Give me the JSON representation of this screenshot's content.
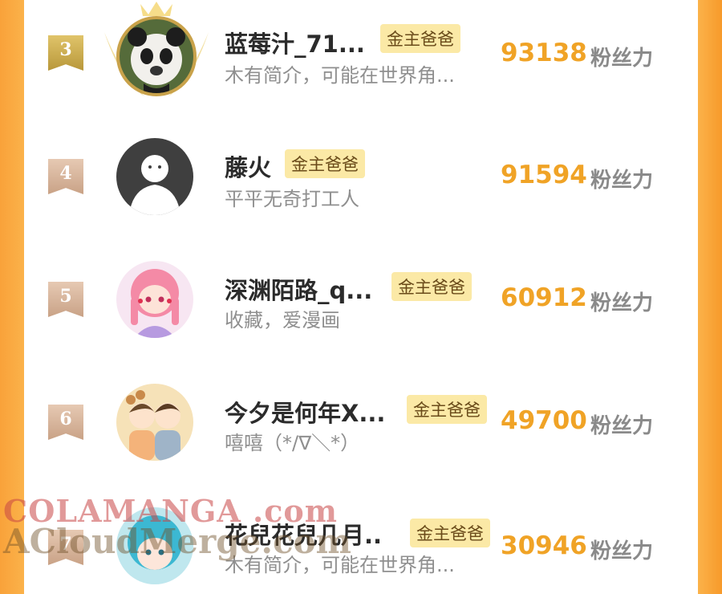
{
  "entries": [
    {
      "rank": "3",
      "name": "蓝莓汁_71...",
      "badge": "金主爸爸",
      "bio": "木有简介，可能在世界角...",
      "score": "93138",
      "unit": "粉丝力",
      "avatar": "panda-avatar"
    },
    {
      "rank": "4",
      "name": "藤火",
      "badge": "金主爸爸",
      "bio": "平平无奇打工人",
      "score": "91594",
      "unit": "粉丝力",
      "avatar": "default-avatar"
    },
    {
      "rank": "5",
      "name": "深渊陌路_q...",
      "badge": "金主爸爸",
      "bio": "收藏，爱漫画",
      "score": "60912",
      "unit": "粉丝力",
      "avatar": "anime-girl-avatar"
    },
    {
      "rank": "6",
      "name": "今夕是何年X...",
      "badge": "金主爸爸",
      "bio": "嘻嘻（*/∇＼*）",
      "score": "49700",
      "unit": "粉丝力",
      "avatar": "couple-cartoon-avatar"
    },
    {
      "rank": "7",
      "name": "花兒花兒几月..",
      "badge": "金主爸爸",
      "bio": "木有简介，可能在世界角...",
      "score": "30946",
      "unit": "粉丝力",
      "avatar": "blue-hair-avatar"
    }
  ],
  "watermark": {
    "line1": "COLAMANGA .com",
    "line2": "ACloudMerge.com"
  },
  "colors": {
    "accent": "#f0a326",
    "badge_bg": "#fbe9a6",
    "side": "#fbb24a"
  }
}
